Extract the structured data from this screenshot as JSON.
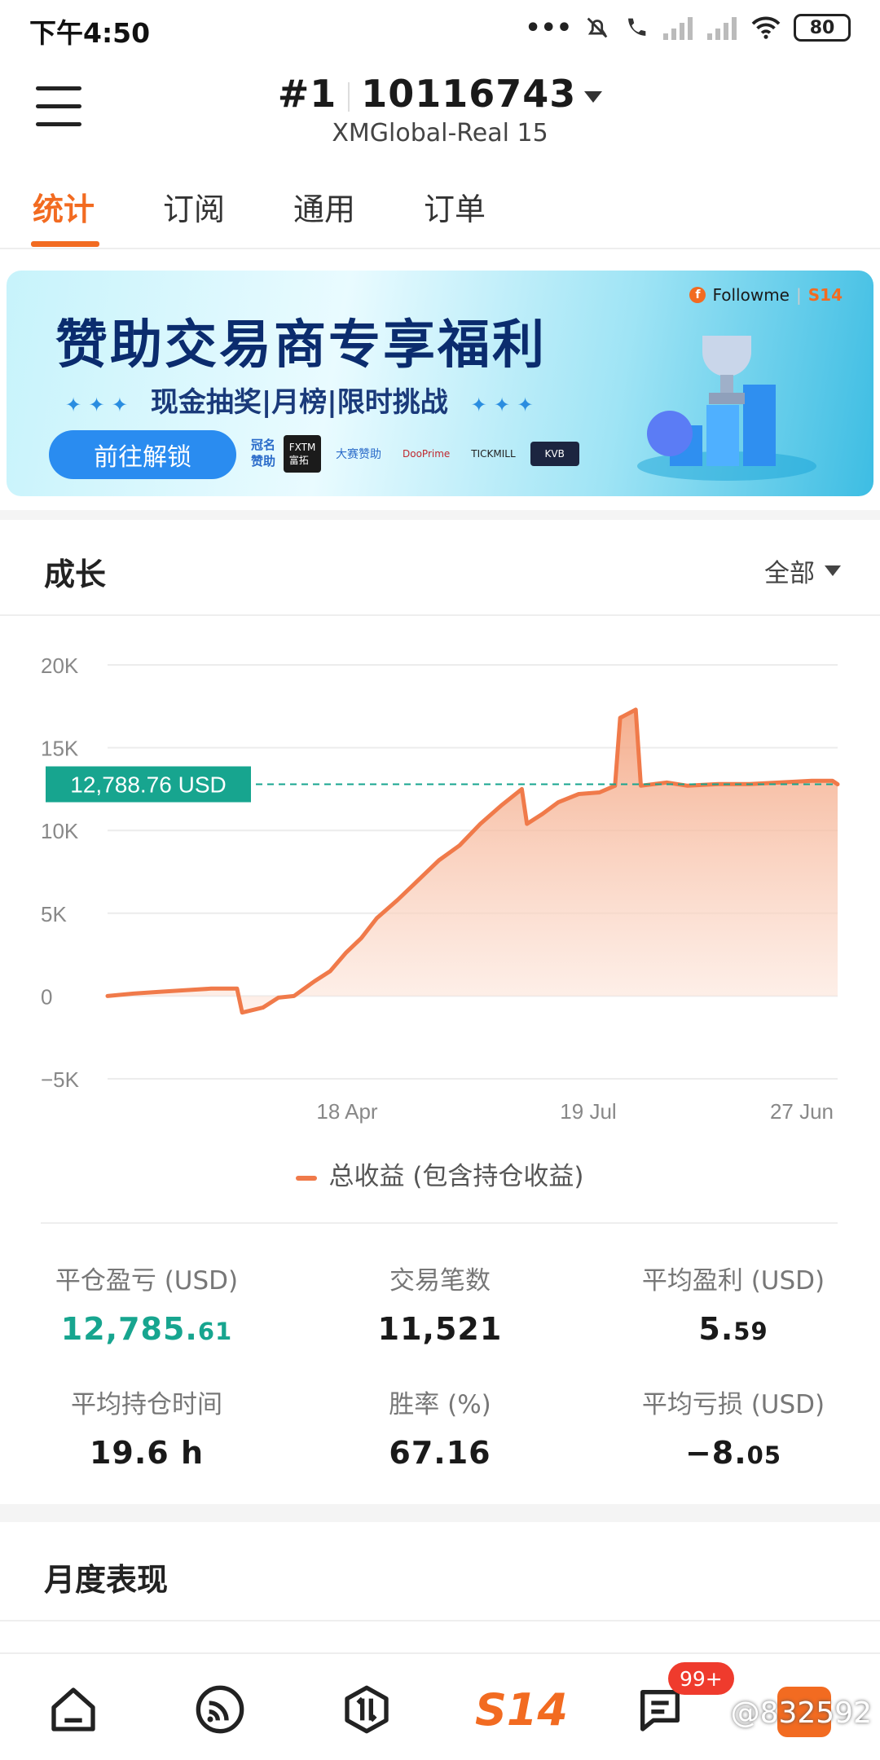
{
  "status_bar": {
    "time": "下午4:50",
    "battery": "80"
  },
  "header": {
    "rank": "#1",
    "account_id": "10116743",
    "server": "XMGlobal-Real 15"
  },
  "tabs": [
    {
      "label": "统计",
      "active": true
    },
    {
      "label": "订阅",
      "active": false
    },
    {
      "label": "通用",
      "active": false
    },
    {
      "label": "订单",
      "active": false
    }
  ],
  "banner": {
    "title": "赞助交易商专享福利",
    "subtitle": "现金抽奖|月榜|限时挑战",
    "button_label": "前往解锁",
    "sponsor_label": "冠名\n赞助",
    "sponsors": [
      "FXTM 富拓",
      "大赛赞助",
      "DooPrime",
      "TICKMILL",
      "KVB"
    ],
    "brand": "Followme",
    "brand_s14": "S14"
  },
  "growth": {
    "title": "成长",
    "filter": "全部",
    "current_value_label": "12,788.76 USD"
  },
  "chart_data": {
    "type": "area",
    "title": "",
    "xlabel": "",
    "ylabel": "",
    "yticks": [
      "20K",
      "15K",
      "10K",
      "5K",
      "0",
      "−5K"
    ],
    "ylim": [
      -5000,
      20000
    ],
    "xticks": [
      "18 Apr",
      "19 Jul",
      "27 Jun"
    ],
    "reference_value": 12788.76,
    "series": [
      {
        "name": "总收益 (包含持仓收益)",
        "color": "#f07a4a",
        "points": [
          [
            0,
            0
          ],
          [
            5,
            150
          ],
          [
            10,
            250
          ],
          [
            15,
            350
          ],
          [
            20,
            450
          ],
          [
            25,
            450
          ],
          [
            26,
            -1000
          ],
          [
            30,
            -700
          ],
          [
            33,
            -100
          ],
          [
            36,
            0
          ],
          [
            40,
            900
          ],
          [
            43,
            1500
          ],
          [
            46,
            2600
          ],
          [
            49,
            3500
          ],
          [
            52,
            4700
          ],
          [
            56,
            5800
          ],
          [
            60,
            7000
          ],
          [
            64,
            8200
          ],
          [
            68,
            9100
          ],
          [
            72,
            10400
          ],
          [
            76,
            11500
          ],
          [
            80,
            12500
          ],
          [
            81,
            10400
          ],
          [
            84,
            11000
          ],
          [
            87,
            11700
          ],
          [
            91,
            12200
          ],
          [
            95,
            12300
          ],
          [
            98,
            12700
          ],
          [
            99,
            16800
          ],
          [
            102,
            17300
          ],
          [
            103,
            12700
          ],
          [
            108,
            12900
          ],
          [
            112,
            12700
          ],
          [
            118,
            12800
          ],
          [
            124,
            12800
          ],
          [
            130,
            12900
          ],
          [
            136,
            13000
          ],
          [
            140,
            13000
          ],
          [
            141,
            12788.76
          ]
        ]
      }
    ],
    "legend_position": "bottom",
    "grid": true
  },
  "legend_label": "总收益 (包含持仓收益)",
  "stats": [
    {
      "label": "平仓盈亏 (USD)",
      "int": "12,785.",
      "dec": "61",
      "green": true
    },
    {
      "label": "交易笔数",
      "int": "11,521",
      "dec": "",
      "green": false
    },
    {
      "label": "平均盈利 (USD)",
      "int": "5.",
      "dec": "59",
      "green": false
    },
    {
      "label": "平均持仓时间",
      "int": "19.6 h",
      "dec": "",
      "green": false
    },
    {
      "label": "胜率 (%)",
      "int": "67.16",
      "dec": "",
      "green": false
    },
    {
      "label": "平均亏损 (USD)",
      "int": "−8.",
      "dec": "05",
      "green": false
    }
  ],
  "monthly": {
    "title": "月度表现"
  },
  "bottom_nav": {
    "s14_label": "S14",
    "message_badge": "99+",
    "watermark": "@832592"
  }
}
